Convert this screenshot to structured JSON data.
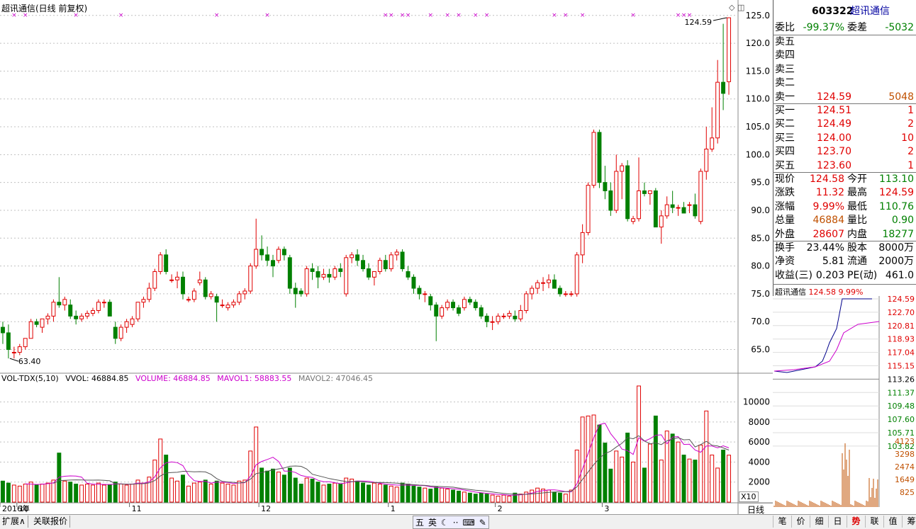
{
  "header": {
    "title": "超讯通信(日线 前复权)"
  },
  "chart_data": {
    "type": "candlestick",
    "price_axis": [
      125.0,
      120.0,
      115.0,
      110.0,
      105.0,
      100.0,
      95.0,
      90.0,
      85.0,
      80.0,
      75.0,
      70.0,
      65.0
    ],
    "price_range": [
      61.0,
      126.5
    ],
    "price_labels": [
      "125.0",
      "120.0",
      "115.0",
      "110.0",
      "105.0",
      "100.0",
      "95.0",
      "90.0",
      "85.0",
      "80.0",
      "75.0",
      "70.0",
      "65.0"
    ],
    "volume_axis": [
      10000,
      8000,
      6000,
      4000,
      2000
    ],
    "volume_range": [
      0,
      11600
    ],
    "volume_labels": [
      "10000",
      "8000",
      "6000",
      "4000",
      "2000"
    ],
    "month_labels": [
      {
        "label": "2016年",
        "x_index": 0
      },
      {
        "label": "10",
        "x_index": 3
      },
      {
        "label": "11",
        "x_index": 23
      },
      {
        "label": "12",
        "x_index": 46
      },
      {
        "label": "1",
        "x_index": 69
      },
      {
        "label": "2",
        "x_index": 88
      },
      {
        "label": "3",
        "x_index": 107
      }
    ],
    "annotations": [
      {
        "text": "124.59",
        "kind": "high"
      },
      {
        "text": "63.40",
        "kind": "low"
      }
    ],
    "marker_days": [
      2,
      4,
      13,
      21,
      38,
      47,
      68,
      69,
      71,
      72,
      76,
      79,
      81,
      84,
      86,
      98,
      100,
      103,
      112,
      120,
      121,
      122
    ],
    "ohlcv": [
      [
        69.0,
        70.0,
        66.0,
        68.0,
        2100
      ],
      [
        68.0,
        69.5,
        63.4,
        65.0,
        1900
      ],
      [
        64.5,
        65.5,
        63.4,
        64.5,
        1700
      ],
      [
        64.5,
        66.0,
        64.0,
        65.5,
        1600
      ],
      [
        65.5,
        67.0,
        65.0,
        67.0,
        1800
      ],
      [
        67.0,
        70.5,
        67.0,
        70.0,
        2000
      ],
      [
        70.0,
        70.5,
        69.0,
        69.5,
        1700
      ],
      [
        69.0,
        70.5,
        68.0,
        70.5,
        1800
      ],
      [
        70.5,
        71.5,
        69.5,
        71.0,
        1900
      ],
      [
        71.0,
        74.0,
        70.0,
        73.5,
        2200
      ],
      [
        73.5,
        78.0,
        72.5,
        73.0,
        4900
      ],
      [
        73.0,
        74.5,
        72.0,
        74.0,
        2100
      ],
      [
        73.0,
        74.0,
        70.5,
        71.0,
        2000
      ],
      [
        71.0,
        72.0,
        69.5,
        70.5,
        1800
      ],
      [
        70.5,
        71.5,
        70.0,
        71.0,
        1700
      ],
      [
        71.0,
        72.0,
        70.5,
        71.5,
        1800
      ],
      [
        71.5,
        72.5,
        71.0,
        72.0,
        1700
      ],
      [
        72.0,
        74.0,
        71.5,
        73.5,
        1900
      ],
      [
        73.5,
        74.0,
        72.5,
        73.5,
        1700
      ],
      [
        73.5,
        74.0,
        71.0,
        71.0,
        1700
      ],
      [
        69.0,
        70.0,
        66.0,
        67.0,
        2000
      ],
      [
        67.0,
        69.5,
        66.5,
        69.0,
        1800
      ],
      [
        69.0,
        70.5,
        68.0,
        70.0,
        1700
      ],
      [
        69.5,
        71.0,
        69.0,
        70.5,
        1800
      ],
      [
        70.5,
        73.5,
        70.0,
        73.5,
        2200
      ],
      [
        73.5,
        74.5,
        72.5,
        74.0,
        1900
      ],
      [
        74.0,
        77.0,
        73.5,
        76.0,
        2500
      ],
      [
        76.0,
        79.5,
        75.5,
        79.0,
        4200
      ],
      [
        79.0,
        82.5,
        78.5,
        82.0,
        6300
      ],
      [
        82.0,
        83.0,
        78.5,
        79.0,
        4700
      ],
      [
        77.5,
        78.5,
        77.0,
        77.5,
        2400
      ],
      [
        77.5,
        79.0,
        76.0,
        78.0,
        2100
      ],
      [
        78.0,
        79.0,
        74.0,
        75.0,
        2700
      ],
      [
        74.0,
        74.5,
        73.5,
        74.0,
        1600
      ],
      [
        74.0,
        76.0,
        73.5,
        75.5,
        1900
      ],
      [
        77.0,
        79.0,
        76.5,
        77.5,
        2000
      ],
      [
        77.5,
        78.0,
        74.0,
        74.5,
        2200
      ],
      [
        74.5,
        75.5,
        74.0,
        75.0,
        1800
      ],
      [
        74.5,
        75.0,
        70.0,
        73.5,
        2100
      ],
      [
        73.0,
        74.0,
        72.5,
        73.0,
        1900
      ],
      [
        72.5,
        73.5,
        72.0,
        73.0,
        1800
      ],
      [
        73.0,
        74.0,
        72.5,
        73.5,
        1700
      ],
      [
        73.5,
        75.5,
        73.0,
        75.0,
        2100
      ],
      [
        75.0,
        76.0,
        74.0,
        75.5,
        2200
      ],
      [
        75.5,
        80.5,
        75.0,
        80.0,
        5100
      ],
      [
        80.0,
        88.5,
        79.5,
        83.0,
        7500
      ],
      [
        83.0,
        85.5,
        81.0,
        82.0,
        3400
      ],
      [
        82.0,
        83.5,
        80.0,
        81.0,
        3100
      ],
      [
        81.0,
        82.0,
        78.0,
        80.0,
        3300
      ],
      [
        81.0,
        83.5,
        80.5,
        83.0,
        3000
      ],
      [
        83.0,
        83.5,
        81.0,
        82.0,
        2700
      ],
      [
        81.5,
        82.0,
        75.0,
        76.0,
        3400
      ],
      [
        76.0,
        77.0,
        72.5,
        75.0,
        2400
      ],
      [
        75.5,
        76.0,
        74.5,
        75.0,
        1800
      ],
      [
        75.0,
        80.0,
        74.5,
        79.5,
        2400
      ],
      [
        79.5,
        80.5,
        77.5,
        79.0,
        2300
      ],
      [
        79.0,
        80.0,
        76.0,
        78.0,
        2000
      ],
      [
        78.0,
        79.5,
        77.5,
        78.5,
        1700
      ],
      [
        78.5,
        79.5,
        77.0,
        78.0,
        1800
      ],
      [
        78.0,
        80.0,
        77.5,
        79.5,
        1900
      ],
      [
        79.5,
        80.5,
        78.0,
        79.0,
        1800
      ],
      [
        75.0,
        82.0,
        74.5,
        81.5,
        2400
      ],
      [
        81.5,
        82.5,
        80.5,
        82.0,
        2300
      ],
      [
        82.0,
        83.0,
        80.0,
        81.0,
        2100
      ],
      [
        81.0,
        82.0,
        79.0,
        79.5,
        1900
      ],
      [
        79.5,
        80.5,
        77.5,
        78.0,
        1700
      ],
      [
        78.0,
        79.0,
        76.5,
        79.0,
        1900
      ],
      [
        79.0,
        81.5,
        78.5,
        81.0,
        1800
      ],
      [
        81.0,
        82.0,
        79.0,
        79.5,
        1700
      ],
      [
        79.5,
        82.5,
        79.0,
        82.0,
        1600
      ],
      [
        82.0,
        83.0,
        81.0,
        82.5,
        1500
      ],
      [
        82.5,
        83.0,
        79.0,
        79.5,
        1900
      ],
      [
        79.0,
        80.0,
        77.5,
        78.0,
        1800
      ],
      [
        78.0,
        78.5,
        75.0,
        76.0,
        1600
      ],
      [
        76.0,
        76.5,
        74.0,
        75.0,
        1500
      ],
      [
        75.0,
        75.5,
        73.5,
        75.0,
        1400
      ],
      [
        74.5,
        75.0,
        72.0,
        73.0,
        1300
      ],
      [
        73.0,
        73.5,
        66.5,
        71.0,
        1500
      ],
      [
        71.0,
        73.0,
        70.5,
        72.5,
        1400
      ],
      [
        72.5,
        74.0,
        72.0,
        73.5,
        1300
      ],
      [
        73.5,
        74.0,
        72.0,
        72.5,
        1200
      ],
      [
        72.5,
        73.0,
        71.0,
        71.5,
        1100
      ],
      [
        72.5,
        74.5,
        72.0,
        74.0,
        1000
      ],
      [
        74.0,
        74.5,
        73.0,
        73.5,
        900
      ],
      [
        73.5,
        74.0,
        72.0,
        72.5,
        800
      ],
      [
        72.5,
        73.0,
        70.5,
        71.0,
        900
      ],
      [
        71.0,
        71.5,
        69.0,
        70.0,
        800
      ],
      [
        70.0,
        71.0,
        68.5,
        70.0,
        700
      ],
      [
        70.0,
        71.5,
        69.5,
        71.0,
        600
      ],
      [
        71.0,
        71.5,
        70.5,
        71.0,
        700
      ],
      [
        71.0,
        72.0,
        70.5,
        71.5,
        600
      ],
      [
        71.0,
        72.0,
        70.0,
        70.5,
        900
      ],
      [
        70.5,
        73.0,
        70.0,
        72.0,
        800
      ],
      [
        72.0,
        75.5,
        71.5,
        75.0,
        1000
      ],
      [
        75.0,
        76.5,
        74.0,
        76.0,
        1200
      ],
      [
        76.0,
        77.5,
        75.0,
        77.0,
        1400
      ],
      [
        77.0,
        78.0,
        75.5,
        77.0,
        1300
      ],
      [
        77.0,
        78.5,
        76.0,
        77.5,
        1200
      ],
      [
        77.5,
        78.5,
        76.0,
        76.0,
        1000
      ],
      [
        76.0,
        76.5,
        74.5,
        75.0,
        900
      ],
      [
        75.0,
        75.5,
        74.5,
        75.0,
        800
      ],
      [
        75.0,
        75.5,
        74.5,
        75.0,
        1200
      ],
      [
        75.0,
        82.5,
        74.5,
        82.0,
        5200
      ],
      [
        82.0,
        87.5,
        80.5,
        86.0,
        8500
      ],
      [
        86.0,
        95.0,
        85.5,
        94.5,
        8600
      ],
      [
        94.5,
        104.5,
        94.0,
        104.0,
        8700
      ],
      [
        104.0,
        104.5,
        94.0,
        95.0,
        7700
      ],
      [
        95.0,
        98.0,
        92.0,
        93.5,
        5900
      ],
      [
        93.5,
        95.0,
        89.0,
        90.0,
        3300
      ],
      [
        90.0,
        100.0,
        89.5,
        97.0,
        5100
      ],
      [
        97.0,
        98.5,
        92.0,
        98.0,
        4500
      ],
      [
        98.0,
        99.0,
        88.0,
        88.5,
        6900
      ],
      [
        88.0,
        89.0,
        87.5,
        88.5,
        4000
      ],
      [
        88.5,
        99.5,
        88.0,
        93.5,
        11600
      ],
      [
        93.5,
        95.0,
        92.5,
        93.0,
        3400
      ],
      [
        93.0,
        93.5,
        91.0,
        93.5,
        5800
      ],
      [
        93.5,
        94.0,
        87.0,
        87.0,
        8600
      ],
      [
        87.0,
        90.0,
        84.0,
        89.0,
        4200
      ],
      [
        89.0,
        92.5,
        88.5,
        91.0,
        7100
      ],
      [
        91.0,
        93.5,
        89.5,
        90.5,
        6800
      ],
      [
        90.5,
        91.0,
        89.0,
        90.5,
        6000
      ],
      [
        90.5,
        91.5,
        89.5,
        89.5,
        4700
      ],
      [
        91.0,
        91.5,
        89.5,
        91.0,
        4300
      ],
      [
        91.0,
        93.0,
        88.5,
        89.0,
        4200
      ],
      [
        88.0,
        97.5,
        87.5,
        97.0,
        5700
      ],
      [
        97.0,
        105.0,
        95.5,
        101.0,
        9100
      ],
      [
        101.0,
        108.5,
        100.5,
        103.0,
        4700
      ],
      [
        103.0,
        117.0,
        102.0,
        113.0,
        3400
      ],
      [
        113.0,
        123.5,
        108.0,
        111.0,
        5200
      ],
      [
        113.1,
        124.59,
        110.76,
        124.58,
        4688
      ]
    ]
  },
  "volume_legend": {
    "name": "VOL-TDX(5,10)",
    "vvol": "VVOL: 46884.85",
    "volume": "VOLUME: 46884.85",
    "mavol1": "MAVOL1: 58883.55",
    "mavol2": "MAVOL2: 47046.45"
  },
  "quote": {
    "code": "603322",
    "name": "超讯通信",
    "weibi_label": "委比",
    "weibi": "-99.37%",
    "weicha_label": "委差",
    "weicha": "-5032",
    "sell": [
      {
        "label": "卖五",
        "price": "",
        "vol": ""
      },
      {
        "label": "卖四",
        "price": "",
        "vol": ""
      },
      {
        "label": "卖三",
        "price": "",
        "vol": ""
      },
      {
        "label": "卖二",
        "price": "",
        "vol": ""
      },
      {
        "label": "卖一",
        "price": "124.59",
        "vol": "5048"
      }
    ],
    "buy": [
      {
        "label": "买一",
        "price": "124.51",
        "vol": "1"
      },
      {
        "label": "买二",
        "price": "124.49",
        "vol": "2"
      },
      {
        "label": "买三",
        "price": "124.00",
        "vol": "10"
      },
      {
        "label": "买四",
        "price": "123.70",
        "vol": "2"
      },
      {
        "label": "买五",
        "price": "123.60",
        "vol": "1"
      }
    ],
    "stats": [
      {
        "l1": "现价",
        "v1": "124.58",
        "c1": "red",
        "l2": "今开",
        "v2": "113.10",
        "c2": "grn"
      },
      {
        "l1": "涨跌",
        "v1": "11.32",
        "c1": "red",
        "l2": "最高",
        "v2": "124.59",
        "c2": "red"
      },
      {
        "l1": "涨幅",
        "v1": "9.99%",
        "c1": "red",
        "l2": "最低",
        "v2": "110.76",
        "c2": "grn"
      },
      {
        "l1": "总量",
        "v1": "46884",
        "c1": "org",
        "l2": "量比",
        "v2": "0.90",
        "c2": "grn"
      },
      {
        "l1": "外盘",
        "v1": "28607",
        "c1": "red",
        "l2": "内盘",
        "v2": "18277",
        "c2": "grn"
      }
    ],
    "fund": [
      {
        "l1": "换手",
        "v1": "23.44%",
        "l2": "股本",
        "v2": "8000万"
      },
      {
        "l1": "净资",
        "v1": "5.81",
        "l2": "流通",
        "v2": "2000万"
      },
      {
        "l1": "收益(三)",
        "v1": "0.203",
        "l2": "PE(动)",
        "v2": "461.0"
      }
    ]
  },
  "intraday": {
    "title": "超讯通信",
    "price": "124.58",
    "pct": "9.99%",
    "price_labels": [
      "124.59",
      "122.70",
      "120.81",
      "118.93",
      "117.04",
      "115.15",
      "113.26",
      "111.37",
      "109.48",
      "107.60",
      "105.71",
      "103.82"
    ],
    "vol_labels": [
      "4123",
      "3298",
      "2474",
      "1649",
      "825"
    ]
  },
  "toolbar": {
    "expand": "扩展∧",
    "related": "关联报价",
    "period": "日线",
    "x10": "X10",
    "ime": [
      "五",
      "英",
      "☾",
      "··",
      "⌨",
      "✎"
    ],
    "right_tabs": [
      "笔",
      "价",
      "细",
      "日",
      "势",
      "联",
      "值",
      "筹"
    ],
    "active_tab": "势"
  },
  "colors": {
    "up": "#e00000",
    "down": "#008000",
    "ma1": "#cc00cc",
    "ma2": "#555555",
    "grid": "#c0c0c0"
  }
}
